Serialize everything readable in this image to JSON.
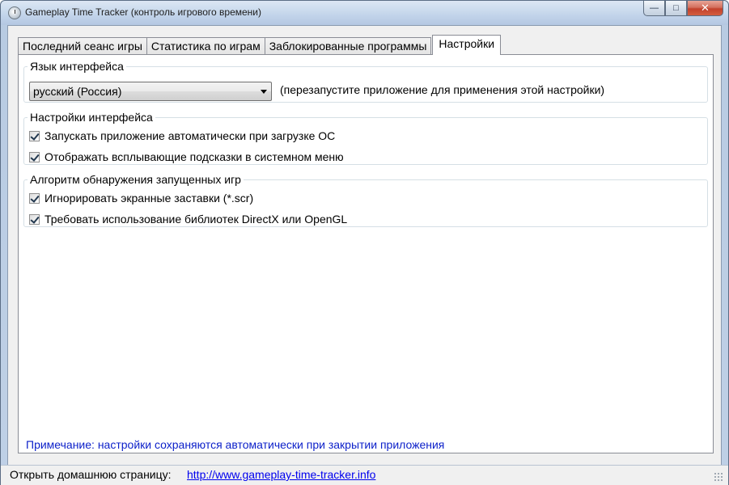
{
  "window": {
    "title": "Gameplay Time Tracker (контроль игрового времени)",
    "minimize_glyph": "—",
    "maximize_glyph": "□",
    "close_glyph": "✕"
  },
  "tabs": [
    {
      "label": "Последний сеанс игры",
      "active": false
    },
    {
      "label": "Статистика по играм",
      "active": false
    },
    {
      "label": "Заблокированные программы",
      "active": false
    },
    {
      "label": "Настройки",
      "active": true
    }
  ],
  "settings": {
    "language": {
      "legend": "Язык интерфейса",
      "selected": "русский (Россия)",
      "hint": "(перезапустите приложение для применения этой настройки)"
    },
    "interface": {
      "legend": "Настройки интерфейса",
      "options": [
        {
          "label": "Запускать приложение автоматически при загрузке ОС",
          "checked": true
        },
        {
          "label": "Отображать всплывающие подсказки в системном меню",
          "checked": true
        }
      ]
    },
    "detection": {
      "legend": "Алгоритм обнаружения запущенных игр",
      "options": [
        {
          "label": "Игнорировать экранные заставки (*.scr)",
          "checked": true
        },
        {
          "label": "Требовать использование библиотек DirectX или OpenGL",
          "checked": true
        }
      ]
    },
    "note": "Примечание: настройки сохраняются автоматически при закрытии приложения"
  },
  "statusbar": {
    "label": "Открыть домашнюю страницу:",
    "link": "http://www.gameplay-time-tracker.info"
  },
  "colors": {
    "note": "#0b1fc9",
    "link": "#0000ee"
  }
}
